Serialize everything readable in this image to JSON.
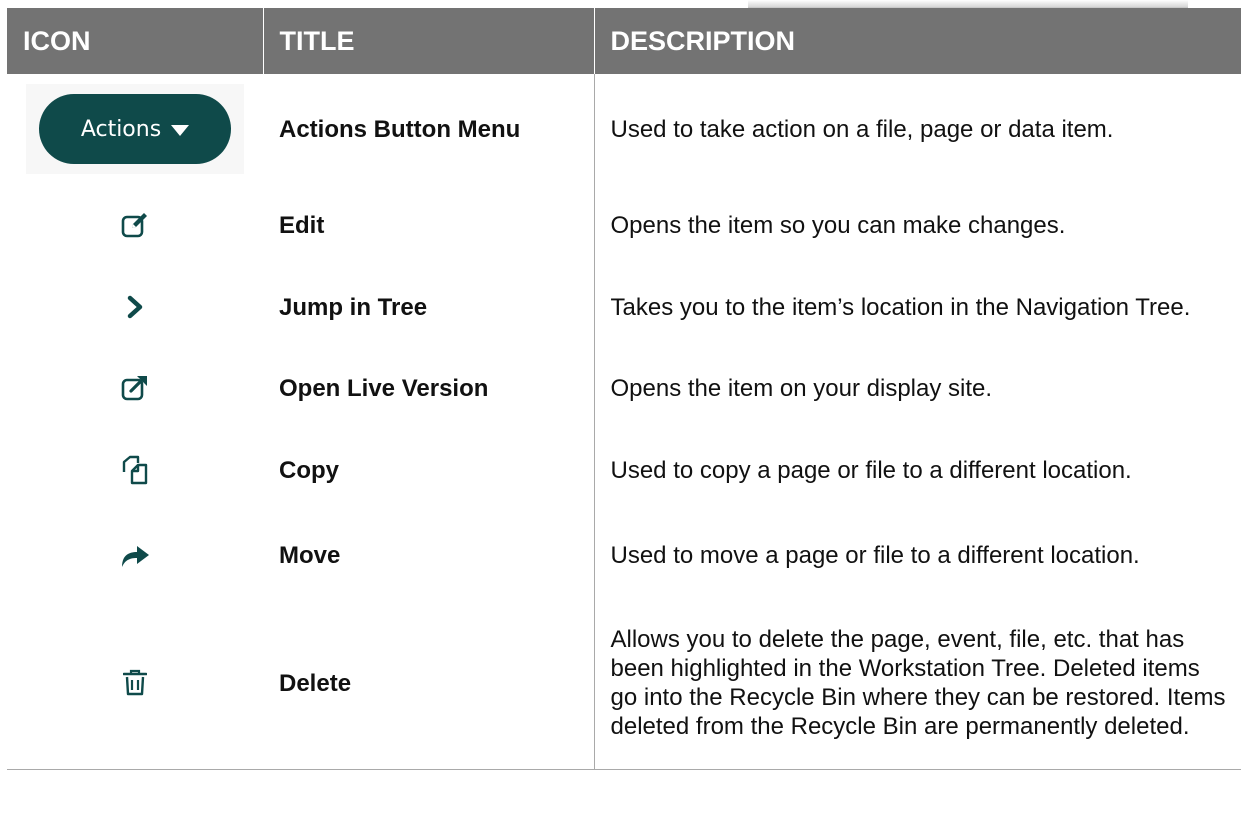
{
  "header": {
    "icon": "ICON",
    "title": "TITLE",
    "description": "DESCRIPTION"
  },
  "rows": [
    {
      "icon": "actions-dropdown-button",
      "button_label": "Actions",
      "title": "Actions Button Menu",
      "description": "Used to take action on a file, page or data item."
    },
    {
      "icon": "edit-icon",
      "title": "Edit",
      "description": "Opens the item so you can make changes."
    },
    {
      "icon": "chevron-right-icon",
      "title": "Jump in Tree",
      "description": "Takes you to the item’s location in the Navigation Tree."
    },
    {
      "icon": "external-link-icon",
      "title": "Open Live Version",
      "description": "Opens the item on your display site."
    },
    {
      "icon": "copy-icon",
      "title": "Copy",
      "description": "Used to copy a page or file to a different location."
    },
    {
      "icon": "move-arrow-icon",
      "title": "Move",
      "description": "Used to move a page or file to a different location."
    },
    {
      "icon": "trash-icon",
      "title": "Delete",
      "description": "Allows you to delete the page, event, file, etc. that has been highlighted in the Workstation Tree. Deleted items go into the Recycle Bin where they can be restored. Items deleted from the Recycle Bin are permanently deleted."
    }
  ],
  "colors": {
    "header_background": "#737373",
    "header_text": "#ffffff",
    "icon_color": "#0f4a4a"
  }
}
